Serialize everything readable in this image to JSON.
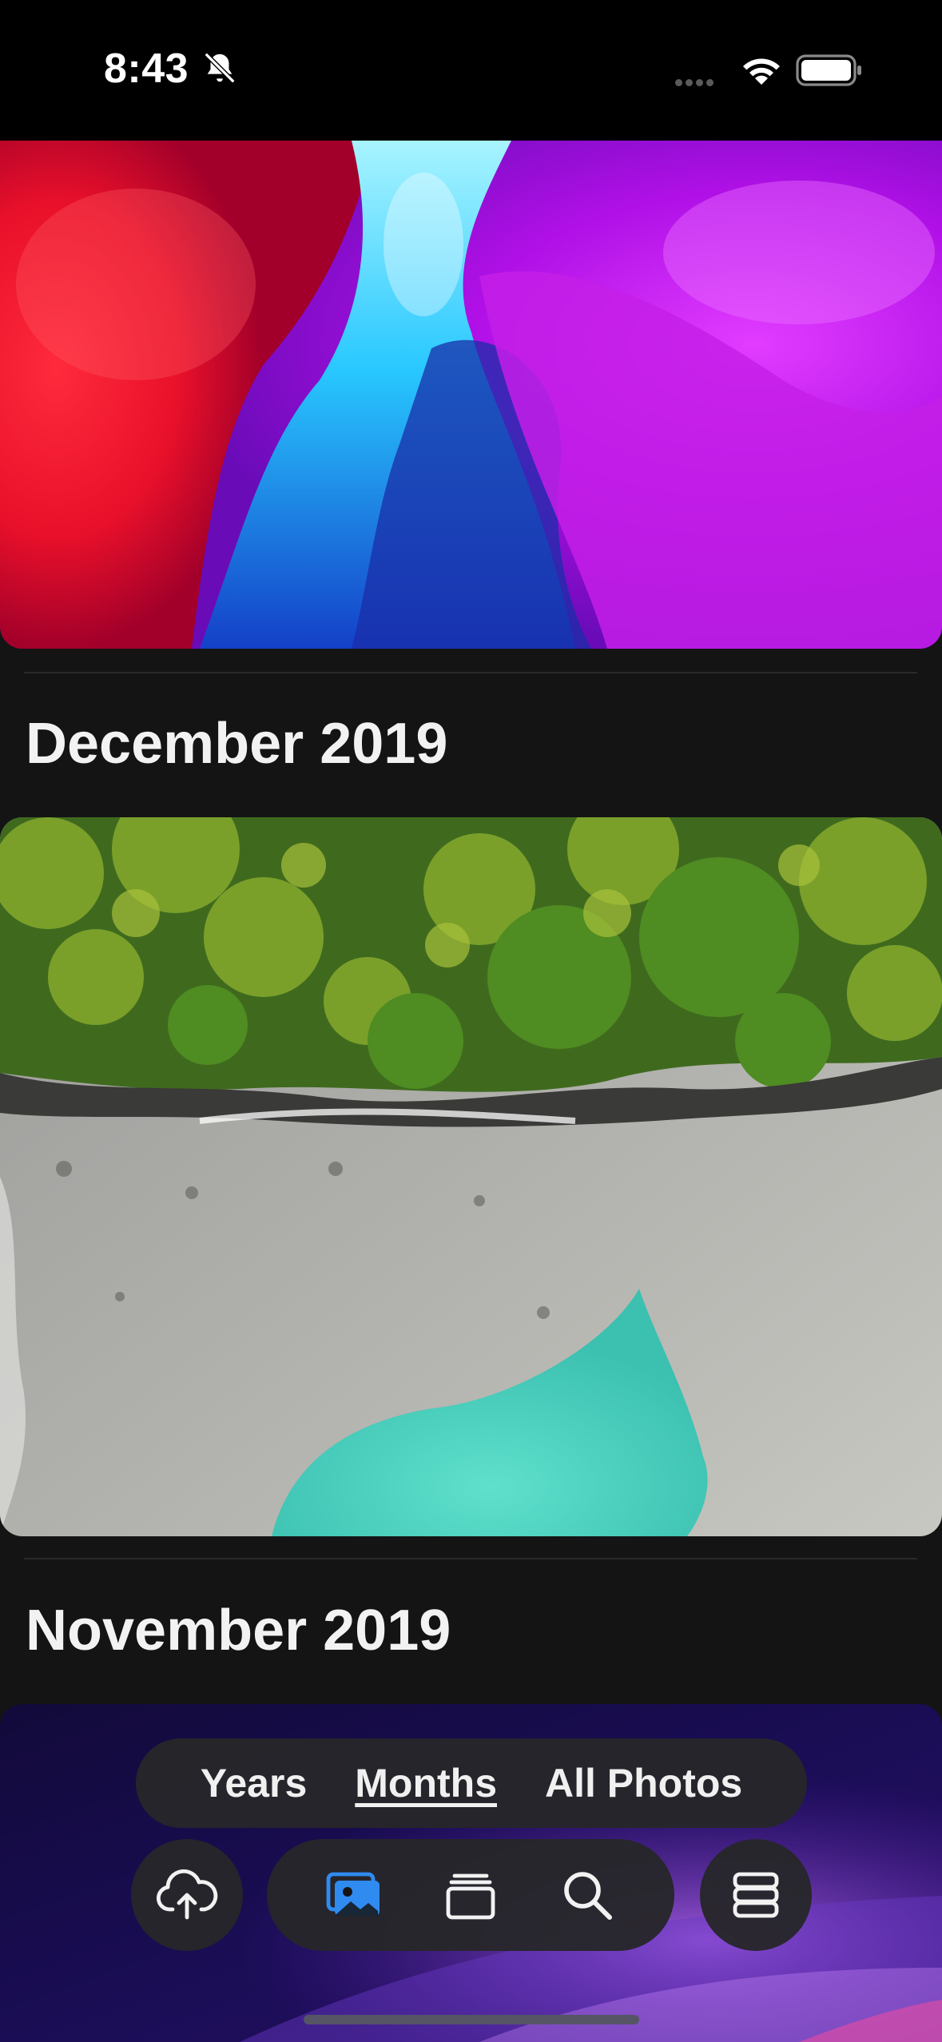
{
  "status_bar": {
    "time": "8:43",
    "icons": [
      "bell-slash-icon",
      "cellular-signal-icon",
      "wifi-icon",
      "battery-icon"
    ]
  },
  "library": {
    "sections": [
      {
        "title": "December 2019",
        "photo": "palm-beach-aerial-photo"
      },
      {
        "title": "November 2019",
        "photo": "purple-wave-photo"
      }
    ],
    "top_photo": "red-purple-abstract-photo"
  },
  "view_switcher": {
    "options": [
      "Years",
      "Months",
      "All Photos"
    ],
    "selected": "Months"
  },
  "tab_bar": {
    "upload": "cloud-upload-icon",
    "tabs": [
      "photos-icon",
      "albums-icon",
      "search-icon"
    ],
    "active_tab": "photos-icon",
    "menu": "server-stack-icon",
    "accent_color": "#2f8bf0"
  },
  "colors": {
    "background": "#141414",
    "status_bar": "#000000",
    "control_bg": "#26262a"
  }
}
